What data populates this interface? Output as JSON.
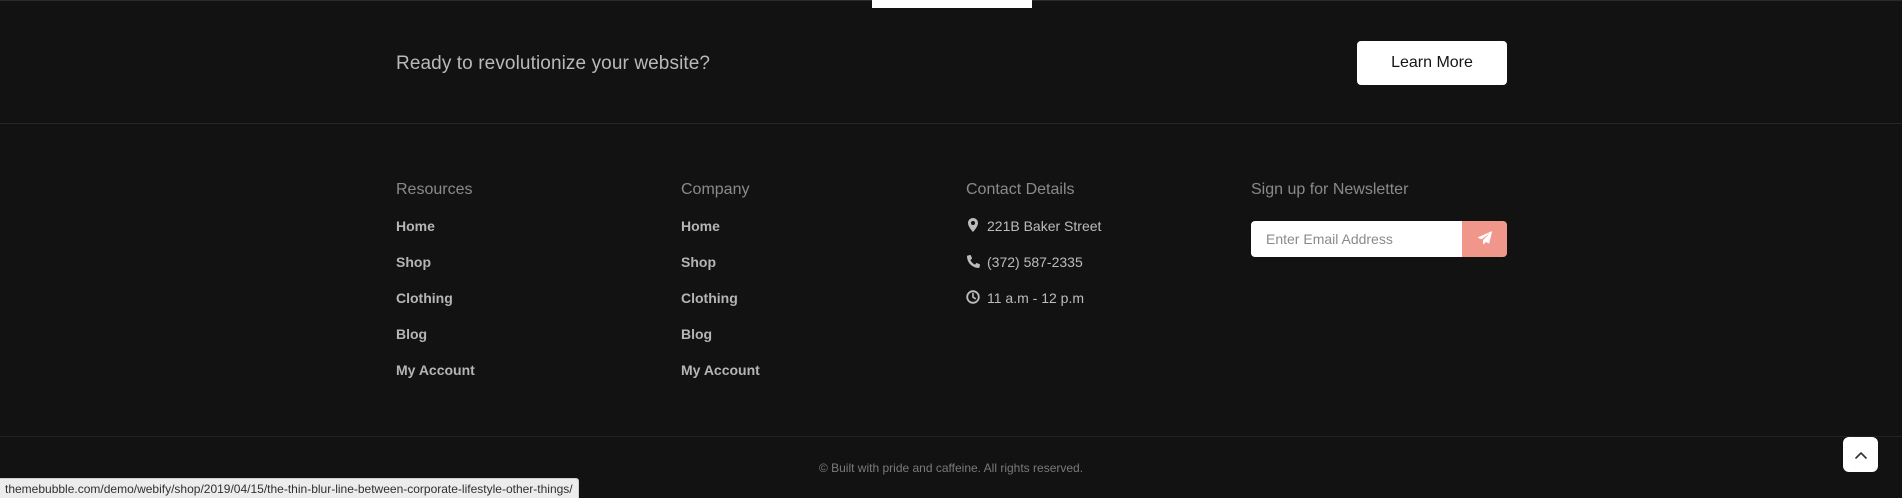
{
  "cta": {
    "text": "Ready to revolutionize your website?",
    "button_label": "Learn More"
  },
  "resources": {
    "heading": "Resources",
    "links": [
      "Home",
      "Shop",
      "Clothing",
      "Blog",
      "My Account"
    ]
  },
  "company": {
    "heading": "Company",
    "links": [
      "Home",
      "Shop",
      "Clothing",
      "Blog",
      "My Account"
    ]
  },
  "contact": {
    "heading": "Contact Details",
    "items": [
      {
        "icon": "map-marker-icon",
        "text": "221B Baker Street"
      },
      {
        "icon": "phone-icon",
        "text": "(372) 587-2335"
      },
      {
        "icon": "clock-icon",
        "text": "11 a.m - 12 p.m"
      }
    ]
  },
  "newsletter": {
    "heading": "Sign up for Newsletter",
    "placeholder": "Enter Email Address",
    "submit_icon": "paper-plane-icon",
    "accent_color": "#f0968b"
  },
  "footer": {
    "copyright": "© Built with pride and caffeine. All rights reserved.",
    "back_to_top_icon": "chevron-up-icon"
  },
  "status_bar": {
    "url": "themebubble.com/demo/webify/shop/2019/04/15/the-thin-blur-line-between-corporate-lifestyle-other-things/"
  }
}
